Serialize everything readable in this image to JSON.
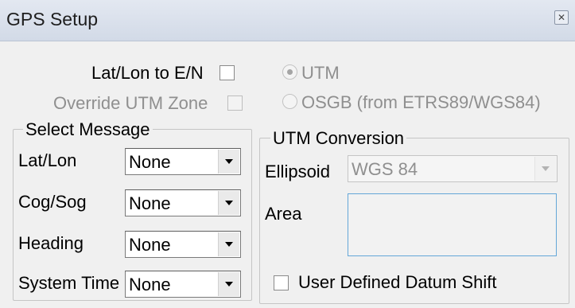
{
  "window": {
    "title": "GPS Setup",
    "close_icon": "close-icon"
  },
  "options": {
    "latlon_to_en_label": "Lat/Lon to E/N",
    "override_utm_zone_label": "Override UTM Zone",
    "radio_utm_label": "UTM",
    "radio_osgb_label": "OSGB (from ETRS89/WGS84)"
  },
  "select_message": {
    "title": "Select Message",
    "rows": [
      {
        "label": "Lat/Lon",
        "value": "None"
      },
      {
        "label": "Cog/Sog",
        "value": "None"
      },
      {
        "label": "Heading",
        "value": "None"
      },
      {
        "label": "System Time",
        "value": "None"
      }
    ]
  },
  "utm_conversion": {
    "title": "UTM Conversion",
    "ellipsoid_label": "Ellipsoid",
    "ellipsoid_value": "WGS 84",
    "area_label": "Area",
    "datum_shift_label": "User Defined Datum Shift"
  },
  "colors": {
    "disabled_text": "#8f8f8f",
    "focus_border": "#64a7d8",
    "titlebar": "#d9e0eb"
  }
}
